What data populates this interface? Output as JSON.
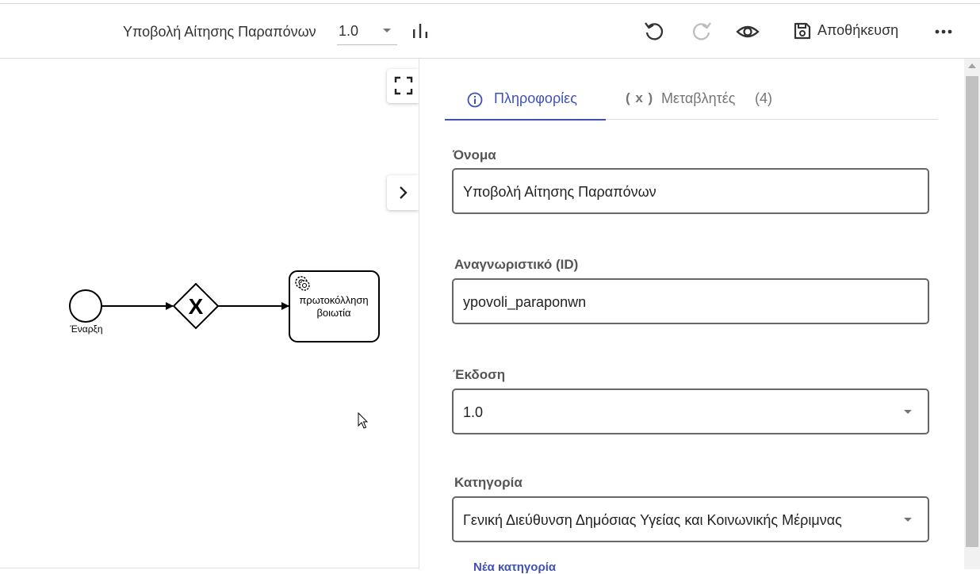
{
  "header": {
    "process_name": "Υποβολή Αίτησης Παραπόνων",
    "version": "1.0",
    "save_label": "Αποθήκευση",
    "icons": [
      "bar-chart-icon",
      "undo-icon",
      "redo-icon",
      "eye-icon",
      "save-icon",
      "more-horizontal-icon"
    ]
  },
  "diagram": {
    "start_event_label": "Έναρξη",
    "gateway_symbol": "X",
    "task_label_line1": "πρωτοκόλληση",
    "task_label_line2": "βοιωτία"
  },
  "panel": {
    "tabs": [
      {
        "label": "Πληροφορίες",
        "active": true
      },
      {
        "label": "Μεταβλητές",
        "prefix": "( x )",
        "count": "(4)",
        "active": false
      }
    ],
    "fields": {
      "name": {
        "label": "Όνομα",
        "value": "Υποβολή Αίτησης Παραπόνων"
      },
      "id": {
        "label": "Αναγνωριστικό (ID)",
        "value": "ypovoli_paraponwn"
      },
      "version": {
        "label": "Έκδοση",
        "value": "1.0"
      },
      "category": {
        "label": "Κατηγορία",
        "value": "Γενική Διεύθυνση Δημόσιας Υγείας και Κοινωνικής Μέριμνας"
      }
    },
    "new_category_link": "Νέα κατηγορία"
  },
  "colors": {
    "accent": "#3f51b5",
    "border": "#666666",
    "text": "#333333"
  }
}
